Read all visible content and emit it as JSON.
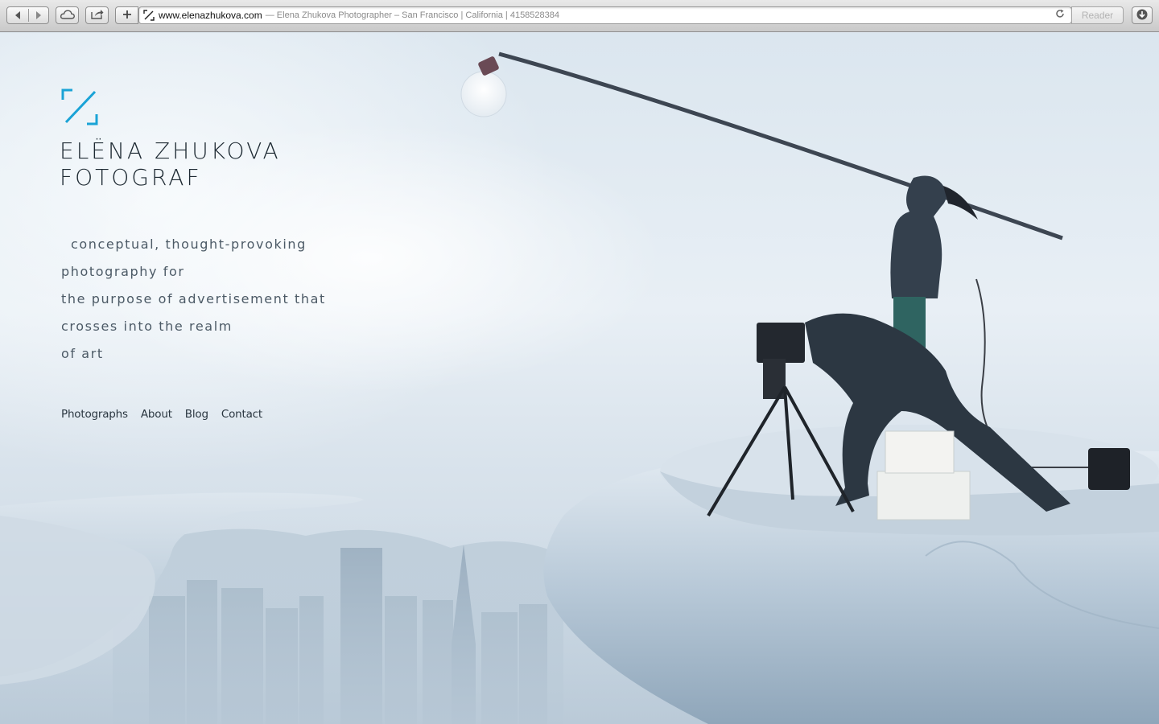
{
  "browser": {
    "url": "www.elenazhukova.com",
    "page_title": "— Elena Zhukova Photographer – San Francisco | California | 4158528384",
    "reader_label": "Reader",
    "buttons": {
      "back_icon": "back-arrow-icon",
      "forward_icon": "forward-arrow-icon",
      "icloud_icon": "cloud-icon",
      "share_icon": "share-icon",
      "new_tab_icon": "plus-icon",
      "reload_icon": "reload-icon",
      "downloads_icon": "download-icon"
    }
  },
  "logo": {
    "name": "ELËNA ZHUKOVA",
    "subtitle": "FOTOGRAF",
    "accent_color": "#1aa3d6"
  },
  "tagline": {
    "lines": [
      "conceptual, thought-provoking",
      "photography for",
      "the purpose of advertisement that",
      "crosses into the realm",
      "of art"
    ]
  },
  "nav": {
    "items": [
      "Photographs",
      "About",
      "Blog",
      "Contact"
    ]
  }
}
